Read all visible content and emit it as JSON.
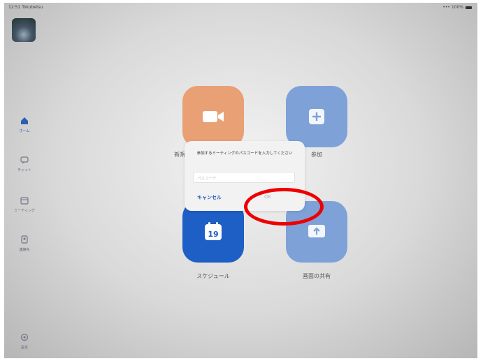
{
  "status_bar": {
    "left": "12:51 Tokubetsu",
    "right": "••• 100%"
  },
  "sidebar": {
    "items": [
      {
        "label": "ホーム",
        "icon": "home-icon",
        "active": true
      },
      {
        "label": "チャット",
        "icon": "chat-icon",
        "active": false
      },
      {
        "label": "ミーティング",
        "icon": "meetings-icon",
        "active": false
      },
      {
        "label": "連絡先",
        "icon": "contacts-icon",
        "active": false
      }
    ],
    "settings_label": "設定"
  },
  "tiles": {
    "new_meeting": {
      "label": "新規ミーティング",
      "color": "#e8a074"
    },
    "join": {
      "label": "参加",
      "color": "#7ea1d8"
    },
    "schedule": {
      "label": "スケジュール",
      "color": "#1d5fc4",
      "date": "19"
    },
    "share_screen": {
      "label": "画面の共有",
      "color": "#7ea1d8"
    }
  },
  "dialog": {
    "message": "参加するミーティングのパスコードを入力してください",
    "input_placeholder": "パスコード",
    "cancel_label": "キャンセル",
    "ok_label": "OK"
  },
  "highlight_color": "#e00000"
}
